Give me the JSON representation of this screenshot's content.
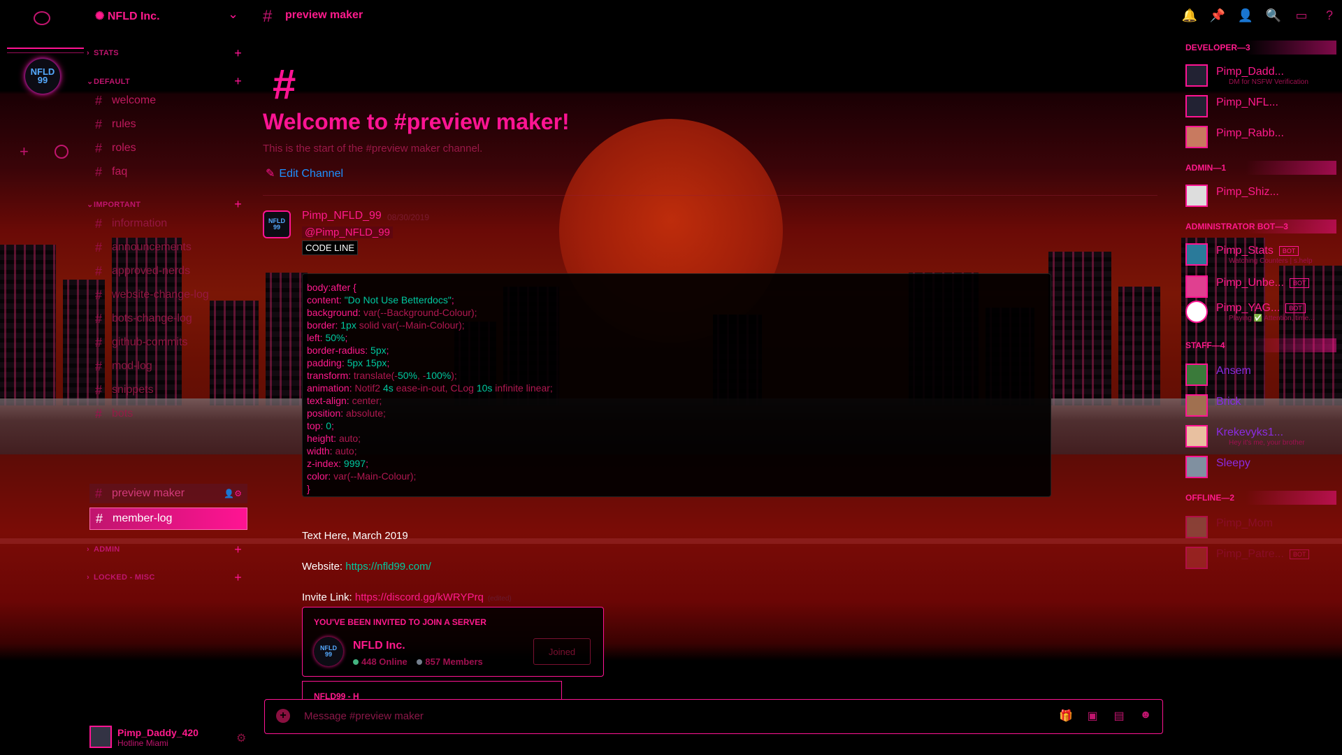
{
  "server": {
    "name": "NFLD Inc."
  },
  "header": {
    "channel": "preview maker"
  },
  "categories": [
    {
      "label": "STATS"
    },
    {
      "label": "DEFAULT"
    },
    {
      "label": "IMPORTANT"
    },
    {
      "label": "ADMIN"
    },
    {
      "label": "LOCKED - MISC"
    }
  ],
  "channels": {
    "default": [
      "welcome",
      "rules",
      "roles",
      "faq"
    ],
    "important": [
      "information",
      "announcements",
      "approved-nerds",
      "website-change-log",
      "bots-change-log",
      "github-commits",
      "mod-log",
      "snippets",
      "bots"
    ],
    "active": "preview maker",
    "selected": "member-log"
  },
  "user": {
    "name": "Pimp_Daddy_420",
    "status": "Hotline Miami"
  },
  "main": {
    "welcome_title": "Welcome to #preview maker!",
    "welcome_sub": "This is the start of the #preview maker channel.",
    "edit_channel": "Edit Channel",
    "message": {
      "author": "Pimp_NFLD_99",
      "date": "08/30/2019",
      "mention": "@Pimp_NFLD_99",
      "code_tag": "CODE LINE"
    },
    "text_here": "Text Here, March 2019",
    "website_label": "Website: ",
    "website_url": "https://nfld99.com/",
    "invite_label": "Invite Link: ",
    "invite_url": "https://discord.gg/kWRYPrq",
    "edited": "(edited)"
  },
  "code": [
    [
      {
        "t": "body:after {",
        "c": "p"
      }
    ],
    [
      {
        "t": "content: ",
        "c": "p"
      },
      {
        "t": "\"Do Not Use Betterdocs\"",
        "c": "v"
      },
      {
        "t": ";",
        "c": "p"
      }
    ],
    [
      {
        "t": "background: ",
        "c": "p"
      },
      {
        "t": "var",
        "c": "f"
      },
      {
        "t": "(--Background-Colour);",
        "c": "f"
      }
    ],
    [
      {
        "t": "border: ",
        "c": "p"
      },
      {
        "t": "1px",
        "c": "v"
      },
      {
        "t": " solid ",
        "c": "f"
      },
      {
        "t": "var",
        "c": "f"
      },
      {
        "t": "(--Main-Colour);",
        "c": "f"
      }
    ],
    [
      {
        "t": "left: ",
        "c": "p"
      },
      {
        "t": "50%",
        "c": "v"
      },
      {
        "t": ";",
        "c": "p"
      }
    ],
    [
      {
        "t": "border-radius: ",
        "c": "p"
      },
      {
        "t": "5px",
        "c": "v"
      },
      {
        "t": ";",
        "c": "p"
      }
    ],
    [
      {
        "t": "padding: ",
        "c": "p"
      },
      {
        "t": "5px 15px",
        "c": "v"
      },
      {
        "t": ";",
        "c": "p"
      }
    ],
    [
      {
        "t": "transform: ",
        "c": "p"
      },
      {
        "t": "translate",
        "c": "f"
      },
      {
        "t": "(-",
        "c": "f"
      },
      {
        "t": "50%",
        "c": "v"
      },
      {
        "t": ", -",
        "c": "f"
      },
      {
        "t": "100%",
        "c": "v"
      },
      {
        "t": ");",
        "c": "f"
      }
    ],
    [
      {
        "t": "animation: ",
        "c": "p"
      },
      {
        "t": "Notif2 ",
        "c": "f"
      },
      {
        "t": "4s",
        "c": "v"
      },
      {
        "t": " ease-in-out, CLog ",
        "c": "f"
      },
      {
        "t": "10s",
        "c": "v"
      },
      {
        "t": " infinite linear;",
        "c": "f"
      }
    ],
    [
      {
        "t": "text-align: ",
        "c": "p"
      },
      {
        "t": "center;",
        "c": "f"
      }
    ],
    [
      {
        "t": "position: ",
        "c": "p"
      },
      {
        "t": "absolute;",
        "c": "f"
      }
    ],
    [
      {
        "t": "top: ",
        "c": "p"
      },
      {
        "t": "0",
        "c": "v"
      },
      {
        "t": ";",
        "c": "p"
      }
    ],
    [
      {
        "t": "height: ",
        "c": "p"
      },
      {
        "t": "auto;",
        "c": "f"
      }
    ],
    [
      {
        "t": "width: ",
        "c": "p"
      },
      {
        "t": "auto;",
        "c": "f"
      }
    ],
    [
      {
        "t": "z-index: ",
        "c": "p"
      },
      {
        "t": "9997",
        "c": "v"
      },
      {
        "t": ";",
        "c": "p"
      }
    ],
    [
      {
        "t": "color: ",
        "c": "p"
      },
      {
        "t": "var",
        "c": "f"
      },
      {
        "t": "(--Main-Colour);",
        "c": "f"
      }
    ],
    [
      {
        "t": "}",
        "c": "p"
      }
    ]
  ],
  "invite": {
    "title": "YOU'VE BEEN INVITED TO JOIN A SERVER",
    "server": "NFLD Inc.",
    "online": "448 Online",
    "members": "857 Members",
    "button": "Joined"
  },
  "card2_title": "NFLD99 - H",
  "composer": {
    "placeholder": "Message #preview maker"
  },
  "members": {
    "roles": [
      {
        "label": "DEVELOPER—3"
      },
      {
        "label": "ADMIN—1"
      },
      {
        "label": "ADMINISTRATOR BOT—3"
      },
      {
        "label": "STAFF—4"
      },
      {
        "label": "OFFLINE—2"
      }
    ],
    "developer": [
      {
        "name": "Pimp_Dadd...",
        "sub": "DM for NSFW Verification"
      },
      {
        "name": "Pimp_NFL..."
      },
      {
        "name": "Pimp_Rabb..."
      }
    ],
    "admin": [
      {
        "name": "Pimp_Shiz..."
      }
    ],
    "bots": [
      {
        "name": "Pimp_Stats",
        "sub": "Watching Counters | s.help",
        "tag": "BOT"
      },
      {
        "name": "Pimp_Unbe...",
        "tag": "BOT"
      },
      {
        "name": "Pimp_YAG...",
        "sub": "Playing ✅ Attention, time...",
        "tag": "BOT"
      }
    ],
    "staff": [
      {
        "name": "Ansem"
      },
      {
        "name": "Brick"
      },
      {
        "name": "Krekevyks1...",
        "sub": "Hey it's me, your brother"
      },
      {
        "name": "Sleepy"
      }
    ],
    "offline": [
      {
        "name": "Pimp_Mom"
      },
      {
        "name": "Pimp_Patre...",
        "tag": "BOT"
      }
    ]
  },
  "colors": {
    "accent": "#ff1493",
    "link": "#1e90ff",
    "code_value": "#00c9a0"
  }
}
